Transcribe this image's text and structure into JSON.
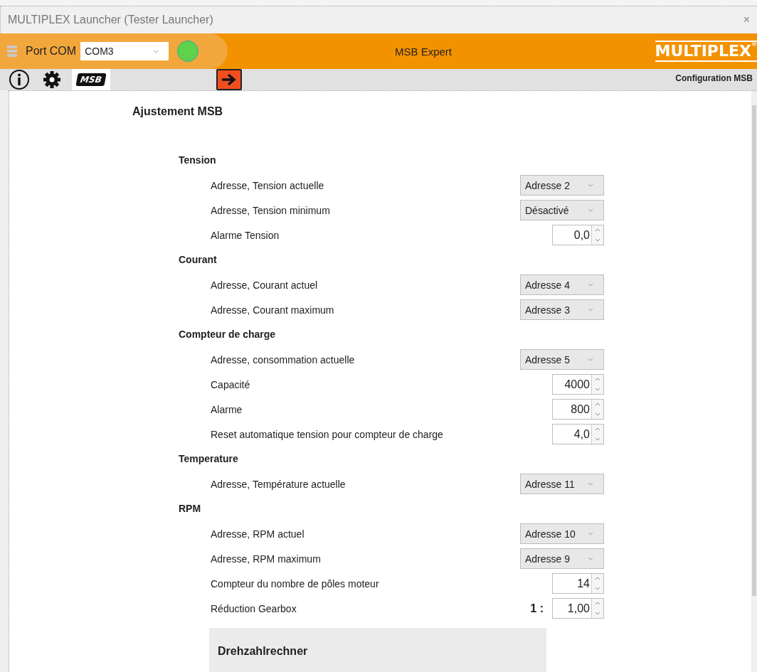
{
  "window": {
    "title": "MULTIPLEX Launcher  (Tester Launcher)",
    "close": "×"
  },
  "header": {
    "port_label": "Port COM",
    "port": "COM3",
    "connected": true,
    "title": "MSB Expert",
    "logo": "MULTIPLEX",
    "logo_mark": "®"
  },
  "toolbar": {
    "msb_label": "MSB",
    "page_title": "Configuration MSB"
  },
  "content": {
    "heading": "Ajustement MSB",
    "sections": [
      {
        "title": "Tension",
        "rows": [
          {
            "label": "Adresse, Tension actuelle",
            "kind": "select",
            "value": "Adresse 2"
          },
          {
            "label": "Adresse, Tension minimum",
            "kind": "select",
            "value": "Désactivé"
          },
          {
            "label": "Alarme Tension",
            "kind": "spin",
            "value": "0,0"
          }
        ]
      },
      {
        "title": "Courant",
        "rows": [
          {
            "label": "Adresse, Courant actuel",
            "kind": "select",
            "value": "Adresse 4"
          },
          {
            "label": "Adresse, Courant maximum",
            "kind": "select",
            "value": "Adresse 3"
          }
        ]
      },
      {
        "title": "Compteur de charge",
        "rows": [
          {
            "label": "Adresse, consommation actuelle",
            "kind": "select",
            "value": "Adresse 5"
          },
          {
            "label": "Capacité",
            "kind": "spin",
            "value": "4000"
          },
          {
            "label": "Alarme",
            "kind": "spin",
            "value": "800"
          },
          {
            "label": "Reset automatique tension pour compteur de charge",
            "kind": "spin",
            "value": "4,0"
          }
        ]
      },
      {
        "title": "Temperature",
        "rows": [
          {
            "label": "Adresse, Température actuelle",
            "kind": "select",
            "value": "Adresse 11"
          }
        ]
      },
      {
        "title": "RPM",
        "rows": [
          {
            "label": "Adresse, RPM actuel",
            "kind": "select",
            "value": "Adresse 10"
          },
          {
            "label": "Adresse, RPM maximum",
            "kind": "select",
            "value": "Adresse 9"
          },
          {
            "label": "Compteur du nombre de pôles moteur",
            "kind": "spin",
            "value": "14"
          },
          {
            "label": "Réduction Gearbox",
            "kind": "spin",
            "prefix": "1 :",
            "value": "1,00"
          }
        ]
      }
    ],
    "subpanel": "Drehzahlrechner"
  }
}
